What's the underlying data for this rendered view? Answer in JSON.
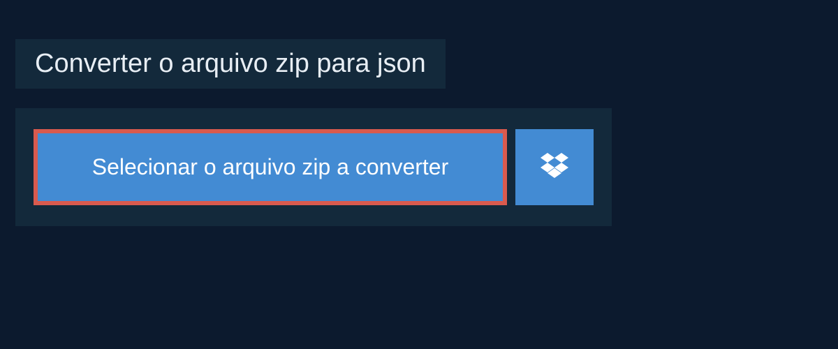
{
  "header": {
    "title": "Converter o arquivo zip para json"
  },
  "actions": {
    "select_file_label": "Selecionar o arquivo zip a converter"
  },
  "colors": {
    "page_bg": "#0c1a2e",
    "panel_bg": "#13293b",
    "button_bg": "#438bd3",
    "button_border_highlight": "#d95a4e",
    "text_light": "#e8eef4",
    "text_white": "#ffffff"
  },
  "icons": {
    "dropbox": "dropbox-icon"
  }
}
